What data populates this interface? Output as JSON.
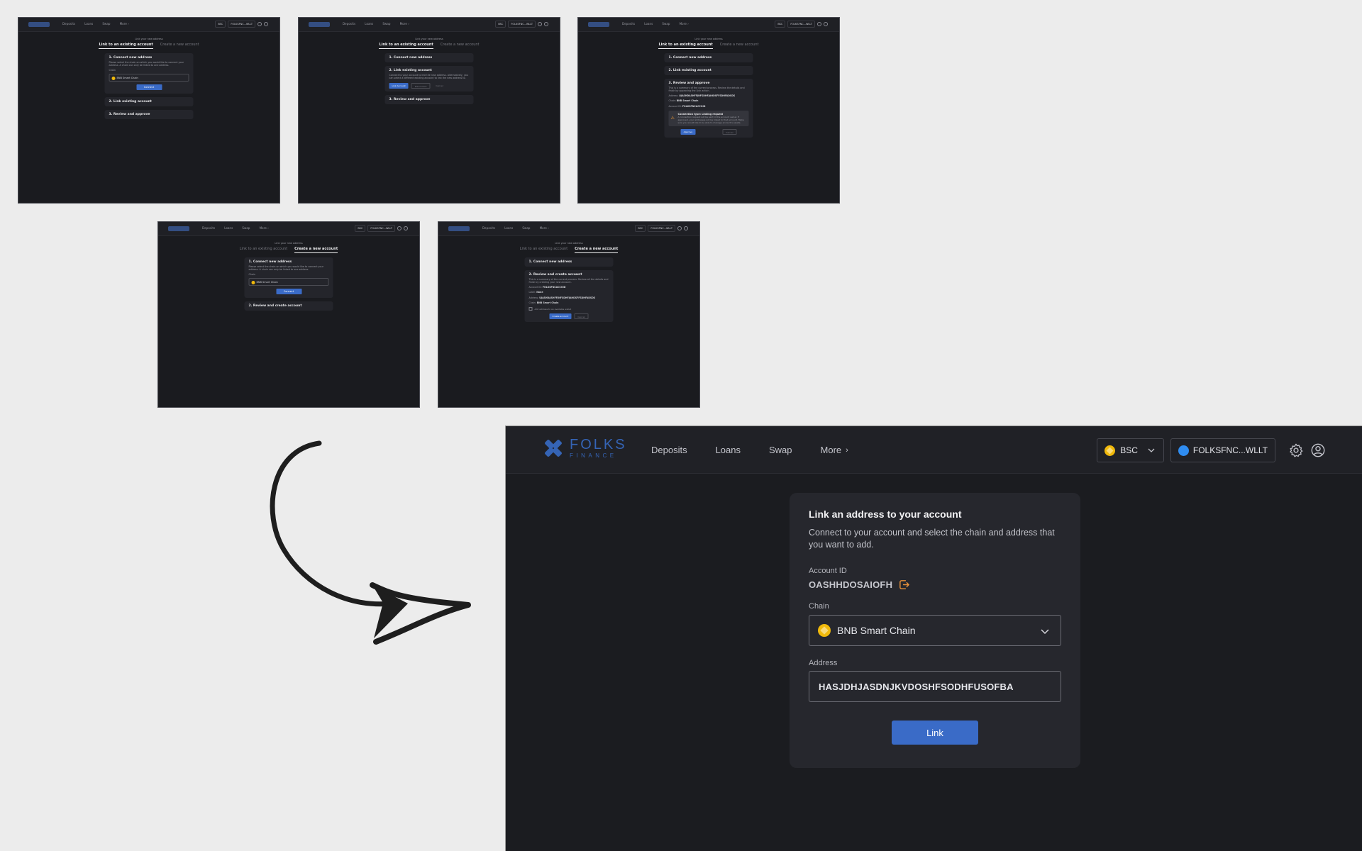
{
  "thumbnails": {
    "nav": {
      "links": [
        "Deposits",
        "Loans",
        "Swap",
        "More ›"
      ],
      "chain": "BSC",
      "wallet": "FOLKSFNC...WLLT"
    },
    "subtitle": "Link your new address",
    "tab_link": "Link to an existing account",
    "tab_create": "Create a new account",
    "step_connect": "1. Connect new address",
    "step_connect_desc": "Please select the chain on which you would like to connect your address. A chain can only be linked to one address.",
    "chain_label": "Chain",
    "chain_value": "BNB Smart Chain",
    "connect_btn": "Connect",
    "step_link": "2. Link existing account",
    "step_link_desc": "Connect to your account to link the new address. Alternatively, you can select a different existing account to link the new address to.",
    "link_account_btn": "Link Account",
    "disconnect_btn": "Disconnect",
    "cancel": "Cancel",
    "step_review": "3. Review and approve",
    "step_review_desc": "This is a summary of the current process. Review the details and finish by approving the Link action.",
    "addr_label": "Address:",
    "addr_value": "UJASHDASHFFJNFSDHFJAHDSFFSDHFADSDS",
    "chain_kv_label": "Chain:",
    "account_id_label": "Account ID:",
    "account_id_value": "FOLKSFNCACCOID",
    "warn_title": "Connection type: Linking request",
    "warn_desc": "A connection request will be sent to the account owner. If approved, your addresses will be linked to that account. Make sure you would like to be able to manage account's assets.",
    "approve_btn": "Approve",
    "step_review_create": "2. Review and create account",
    "step_review_create_desc": "This is a summary of the current process. Review all the details and finish by creating your new account.",
    "account_id_value2": "FOLKSFNCACCOID",
    "label_label": "Label:",
    "label_value": "None",
    "address_kv_value": "UJASHDASHFFJNFSDHFJAHDSFFSDHFADSDS",
    "check_text": "Add address to an available wallet",
    "create_btn": "Create account"
  },
  "main": {
    "logo_top": "FOLKS",
    "logo_bottom": "FINANCE",
    "nav": {
      "deposits": "Deposits",
      "loans": "Loans",
      "swap": "Swap",
      "more": "More",
      "more_chev": "›"
    },
    "chain_pill": "BSC",
    "wallet_pill": "FOLKSFNC...WLLT",
    "icons": [
      "gear-icon",
      "user-icon",
      "copy-icon",
      "chevron-down-icon",
      "bnb-coin-icon"
    ],
    "card": {
      "title": "Link an address to your account",
      "description": "Connect to your account and select the chain and address that you want to add.",
      "account_id_label": "Account ID",
      "account_id_value": "OASHHDOSAIOFH",
      "chain_label": "Chain",
      "chain_value": "BNB Smart Chain",
      "address_label": "Address",
      "address_value": "HASJDHJASDNJKVDOSHFSODHFUSOFBA",
      "link_button": "Link"
    }
  },
  "colors": {
    "page_bg": "#ececec",
    "app_bg": "#1b1c20",
    "card_bg": "#26272d",
    "accent_blue": "#3a6bc7",
    "bnb_yellow": "#f0b90b",
    "copy_orange": "#e8913a"
  }
}
